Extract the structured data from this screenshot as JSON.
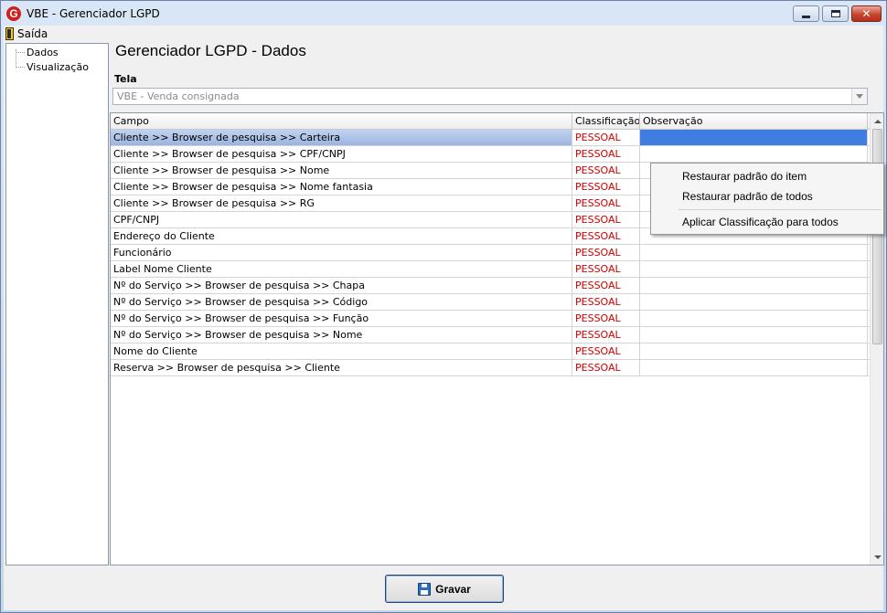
{
  "window": {
    "title": "VBE - Gerenciador LGPD",
    "app_icon_glyph": "G"
  },
  "menu": {
    "exit_label": "Saída"
  },
  "tree": {
    "items": [
      {
        "label": "Dados"
      },
      {
        "label": "Visualização"
      }
    ]
  },
  "main": {
    "title": "Gerenciador LGPD - Dados",
    "screen_label": "Tela",
    "screen_value": "VBE - Venda consignada"
  },
  "grid": {
    "headers": {
      "campo": "Campo",
      "classificacao": "Classificação",
      "observacao": "Observação"
    },
    "rows": [
      {
        "campo": "Cliente >> Browser de pesquisa >> Carteira",
        "classificacao": "PESSOAL",
        "observacao": "",
        "selected": true
      },
      {
        "campo": "Cliente >> Browser de pesquisa >> CPF/CNPJ",
        "classificacao": "PESSOAL",
        "observacao": ""
      },
      {
        "campo": "Cliente >> Browser de pesquisa >> Nome",
        "classificacao": "PESSOAL",
        "observacao": ""
      },
      {
        "campo": "Cliente >> Browser de pesquisa >> Nome fantasia",
        "classificacao": "PESSOAL",
        "observacao": ""
      },
      {
        "campo": "Cliente >> Browser de pesquisa >> RG",
        "classificacao": "PESSOAL",
        "observacao": ""
      },
      {
        "campo": "CPF/CNPJ",
        "classificacao": "PESSOAL",
        "observacao": ""
      },
      {
        "campo": "Endereço do Cliente",
        "classificacao": "PESSOAL",
        "observacao": ""
      },
      {
        "campo": "Funcionário",
        "classificacao": "PESSOAL",
        "observacao": ""
      },
      {
        "campo": "Label Nome Cliente",
        "classificacao": "PESSOAL",
        "observacao": ""
      },
      {
        "campo": "Nº do Serviço >> Browser de pesquisa >> Chapa",
        "classificacao": "PESSOAL",
        "observacao": ""
      },
      {
        "campo": "Nº do Serviço >> Browser de pesquisa >> Código",
        "classificacao": "PESSOAL",
        "observacao": ""
      },
      {
        "campo": "Nº do Serviço >> Browser de pesquisa >> Função",
        "classificacao": "PESSOAL",
        "observacao": ""
      },
      {
        "campo": "Nº do Serviço >> Browser de pesquisa >> Nome",
        "classificacao": "PESSOAL",
        "observacao": ""
      },
      {
        "campo": "Nome do Cliente",
        "classificacao": "PESSOAL",
        "observacao": ""
      },
      {
        "campo": "Reserva >> Browser de pesquisa >> Cliente",
        "classificacao": "PESSOAL",
        "observacao": ""
      }
    ]
  },
  "context_menu": {
    "items": [
      "Restaurar padrão do item",
      "Restaurar padrão de todos",
      "Aplicar Classificação para todos"
    ]
  },
  "footer": {
    "save_label": "Gravar"
  },
  "colors": {
    "classification_text": "#d00000",
    "selection_blue": "#3f7ee0"
  }
}
